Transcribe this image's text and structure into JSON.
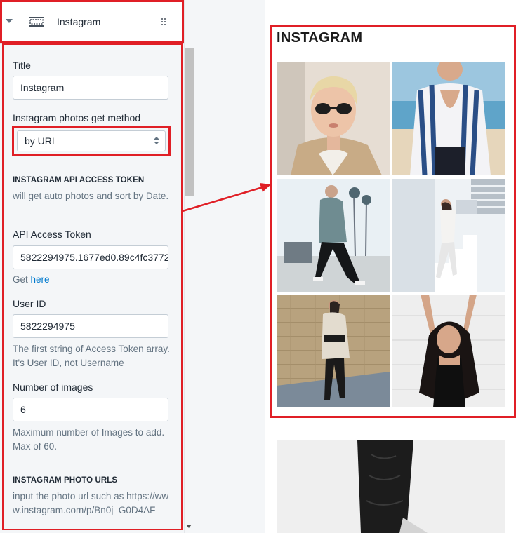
{
  "section": {
    "title": "Instagram",
    "icon": "section-layout-icon",
    "drag_icon": "drag-handle-icon",
    "collapse_icon": "caret-down-icon"
  },
  "fields": {
    "title_label": "Title",
    "title_value": "Instagram",
    "method_label": "Instagram photos get method",
    "method_value": "by URL",
    "api_heading": "INSTAGRAM API ACCESS TOKEN",
    "api_help": "will get auto photos and sort by Date.",
    "token_label": "API Access Token",
    "token_value": "5822294975.1677ed0.89c4fc3772",
    "get_text": "Get ",
    "get_link": "here",
    "user_id_label": "User ID",
    "user_id_value": "5822294975",
    "user_id_help": "The first string of Access Token array. It's User ID, not Username",
    "num_images_label": "Number of images",
    "num_images_value": "6",
    "num_images_help": "Maximum number of Images to add. Max of 60.",
    "urls_heading": "INSTAGRAM PHOTO URLS",
    "urls_help": "input the photo url such as https://www.instagram.com/p/Bn0j_G0D4AF"
  },
  "preview": {
    "heading": "INSTAGRAM",
    "photo_count": 6
  },
  "colors": {
    "annotation_red": "#e01f26",
    "link_blue": "#007ace",
    "help_gray": "#637381"
  }
}
